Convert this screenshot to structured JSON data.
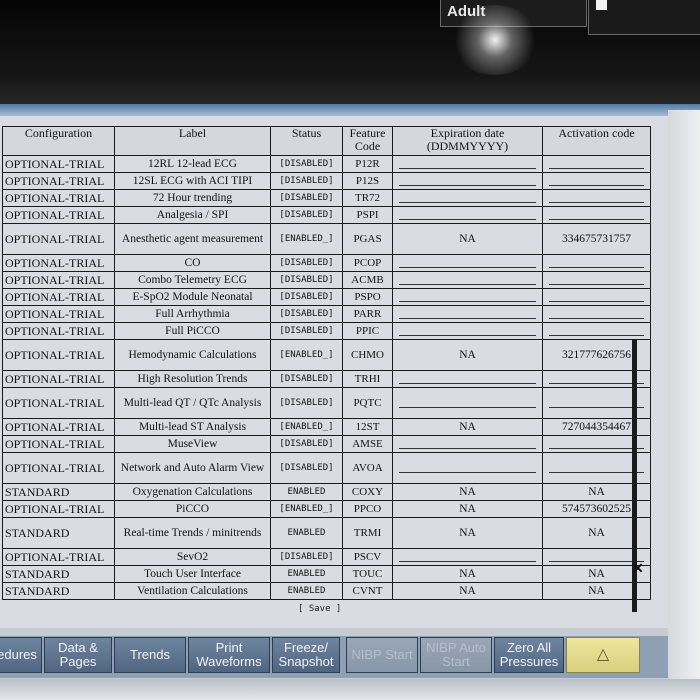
{
  "top": {
    "patient_category": "Adult"
  },
  "table": {
    "headers": [
      "Configuration",
      "Label",
      "Status",
      "Feature Code",
      "Expiration date (DDMMYYYY)",
      "Activation code"
    ],
    "rows": [
      {
        "config": "OPTIONAL-TRIAL",
        "label": "12RL 12-lead ECG",
        "status": "[DISABLED]",
        "code": "P12R",
        "expiration": "",
        "activation": ""
      },
      {
        "config": "OPTIONAL-TRIAL",
        "label": "12SL ECG with ACI TIPI",
        "status": "[DISABLED]",
        "code": "P12S",
        "expiration": "",
        "activation": ""
      },
      {
        "config": "OPTIONAL-TRIAL",
        "label": "72 Hour trending",
        "status": "[DISABLED]",
        "code": "TR72",
        "expiration": "",
        "activation": ""
      },
      {
        "config": "OPTIONAL-TRIAL",
        "label": "Analgesia / SPI",
        "status": "[DISABLED]",
        "code": "PSPI",
        "expiration": "",
        "activation": ""
      },
      {
        "config": "OPTIONAL-TRIAL",
        "label": "Anesthetic agent measurement",
        "status": "[ENABLED_]",
        "code": "PGAS",
        "expiration": "NA",
        "activation": "334675731757",
        "tall": true
      },
      {
        "config": "OPTIONAL-TRIAL",
        "label": "CO",
        "status": "[DISABLED]",
        "code": "PCOP",
        "expiration": "",
        "activation": ""
      },
      {
        "config": "OPTIONAL-TRIAL",
        "label": "Combo Telemetry ECG",
        "status": "[DISABLED]",
        "code": "ACMB",
        "expiration": "",
        "activation": ""
      },
      {
        "config": "OPTIONAL-TRIAL",
        "label": "E-SpO2 Module Neonatal",
        "status": "[DISABLED]",
        "code": "PSPO",
        "expiration": "",
        "activation": ""
      },
      {
        "config": "OPTIONAL-TRIAL",
        "label": "Full Arrhythmia",
        "status": "[DISABLED]",
        "code": "PARR",
        "expiration": "",
        "activation": ""
      },
      {
        "config": "OPTIONAL-TRIAL",
        "label": "Full PiCCO",
        "status": "[DISABLED]",
        "code": "PPIC",
        "expiration": "",
        "activation": ""
      },
      {
        "config": "OPTIONAL-TRIAL",
        "label": "Hemodynamic Calculations",
        "status": "[ENABLED_]",
        "code": "CHMO",
        "expiration": "NA",
        "activation": "321777626756",
        "tall": true
      },
      {
        "config": "OPTIONAL-TRIAL",
        "label": "High Resolution Trends",
        "status": "[DISABLED]",
        "code": "TRHI",
        "expiration": "",
        "activation": ""
      },
      {
        "config": "OPTIONAL-TRIAL",
        "label": "Multi-lead QT / QTc Analysis",
        "status": "[DISABLED]",
        "code": "PQTC",
        "expiration": "",
        "activation": "",
        "tall": true
      },
      {
        "config": "OPTIONAL-TRIAL",
        "label": "Multi-lead ST Analysis",
        "status": "[ENABLED_]",
        "code": "12ST",
        "expiration": "NA",
        "activation": "727044354467"
      },
      {
        "config": "OPTIONAL-TRIAL",
        "label": "MuseView",
        "status": "[DISABLED]",
        "code": "AMSE",
        "expiration": "",
        "activation": ""
      },
      {
        "config": "OPTIONAL-TRIAL",
        "label": "Network and Auto Alarm View",
        "status": "[DISABLED]",
        "code": "AVOA",
        "expiration": "",
        "activation": "",
        "tall": true
      },
      {
        "config": "STANDARD",
        "label": "Oxygenation Calculations",
        "status": "ENABLED",
        "code": "COXY",
        "expiration": "NA",
        "activation": "NA"
      },
      {
        "config": "OPTIONAL-TRIAL",
        "label": "PiCCO",
        "status": "[ENABLED_]",
        "code": "PPCO",
        "expiration": "NA",
        "activation": "574573602525"
      },
      {
        "config": "STANDARD",
        "label": "Real-time Trends / minitrends",
        "status": "ENABLED",
        "code": "TRMI",
        "expiration": "NA",
        "activation": "NA",
        "tall": true
      },
      {
        "config": "OPTIONAL-TRIAL",
        "label": "SevO2",
        "status": "[DISABLED]",
        "code": "PSCV",
        "expiration": "",
        "activation": ""
      },
      {
        "config": "STANDARD",
        "label": "Touch User Interface",
        "status": "ENABLED",
        "code": "TOUC",
        "expiration": "NA",
        "activation": "NA"
      },
      {
        "config": "STANDARD",
        "label": "Ventilation Calculations",
        "status": "ENABLED",
        "code": "CVNT",
        "expiration": "NA",
        "activation": "NA"
      }
    ]
  },
  "save_label": "[ Save ]",
  "softkeys": [
    {
      "label": "edures",
      "state": "normal"
    },
    {
      "label": "Data & Pages",
      "state": "normal"
    },
    {
      "label": "Trends",
      "state": "normal"
    },
    {
      "label": "Print Waveforms",
      "state": "normal"
    },
    {
      "label": "Freeze/ Snapshot",
      "state": "normal"
    },
    {
      "label": "NIBP Start",
      "state": "disabled"
    },
    {
      "label": "NIBP Auto Start",
      "state": "disabled"
    },
    {
      "label": "Zero All Pressures",
      "state": "normal"
    },
    {
      "label": "",
      "icon": "alarm-bell-icon",
      "state": "highlight"
    }
  ]
}
